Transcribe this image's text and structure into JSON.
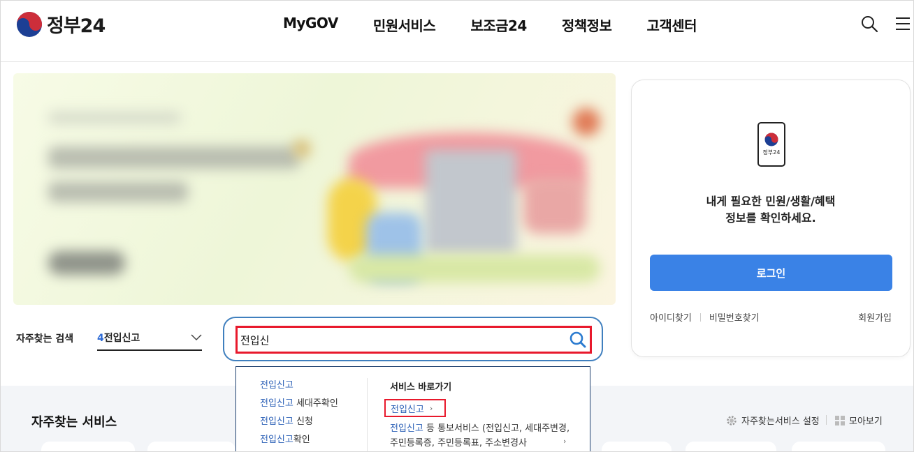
{
  "header": {
    "logo_text": "정부24",
    "nav": [
      "MyGOV",
      "민원서비스",
      "보조금24",
      "정책정보",
      "고객센터"
    ],
    "icons": [
      "search-icon",
      "menu-icon"
    ]
  },
  "search": {
    "fav_label": "자주찾는 검색",
    "fav_rank": "4",
    "fav_keyword": "전입신고",
    "query": "전입신",
    "suggestions": [
      {
        "hl": "전입신고",
        "rest": ""
      },
      {
        "hl": "전입신고",
        "rest": " 세대주확인"
      },
      {
        "hl": "전입신고",
        "rest": " 신청"
      },
      {
        "hl": "전입신고",
        "rest": "확인"
      }
    ],
    "shortcut_title": "서비스 바로가기",
    "shortcut_item": "전입신고",
    "shortcut_arrow": "›",
    "desc_hl": "전입신고",
    "desc_rest": " 등 통보서비스 (전입신고, 세대주변경, 주민등록증, 주민등록표, 주소변경사",
    "desc_arrow": "›"
  },
  "login": {
    "phone_label": "정부24",
    "message_line1": "내게 필요한 민원/생활/혜택",
    "message_line2": "정보를 확인하세요.",
    "login_button": "로그인",
    "find_id": "아이디찾기",
    "find_pw": "비밀번호찾기",
    "join": "회원가입"
  },
  "services": {
    "title": "자주찾는 서비스",
    "setting_label": "자주찾는서비스 설정",
    "all_label": "모아보기"
  },
  "colors": {
    "accent_blue": "#3a82e6",
    "highlight_red": "#e8192c",
    "link_blue": "#2a5fb6"
  }
}
